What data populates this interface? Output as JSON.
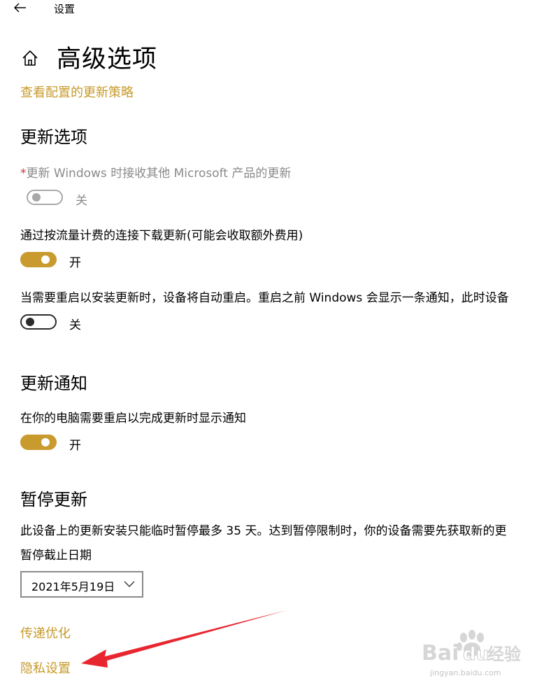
{
  "window": {
    "title": "设置",
    "back_icon": "back-arrow-icon"
  },
  "page": {
    "title": "高级选项",
    "home_icon": "home-icon"
  },
  "links": {
    "policy": "查看配置的更新策略",
    "delivery_optimization": "传递优化",
    "privacy_settings": "隐私设置"
  },
  "sections": {
    "update_options": {
      "title": "更新选项",
      "settings": [
        {
          "asterisk": "*",
          "label": "更新 Windows 时接收其他 Microsoft 产品的更新",
          "state": "关",
          "enabled": false,
          "on": false
        },
        {
          "label": "通过按流量计费的连接下载更新(可能会收取额外费用)",
          "state": "开",
          "enabled": true,
          "on": true
        },
        {
          "label": "当需要重启以安装更新时，设备将自动重启。重启之前 Windows 会显示一条通知，此时设备",
          "state": "关",
          "enabled": true,
          "on": false
        }
      ]
    },
    "update_notifications": {
      "title": "更新通知",
      "settings": [
        {
          "label": "在你的电脑需要重启以完成更新时显示通知",
          "state": "开",
          "enabled": true,
          "on": true
        }
      ]
    },
    "pause_updates": {
      "title": "暂停更新",
      "description": "此设备上的更新安装只能临时暂停最多 35 天。达到暂停限制时，你的设备需要先获取新的更",
      "date_label": "暂停截止日期",
      "date_value": "2021年5月19日"
    }
  },
  "colors": {
    "accent": "#c99a2e",
    "link": "#c79a2a",
    "annotation_arrow": "#e8262f",
    "disabled": "#a8a8a8"
  },
  "watermark": {
    "brand": "Bai",
    "brand2": "du",
    "brand_cn": "经验",
    "url": "jingyan.baidu.com"
  }
}
